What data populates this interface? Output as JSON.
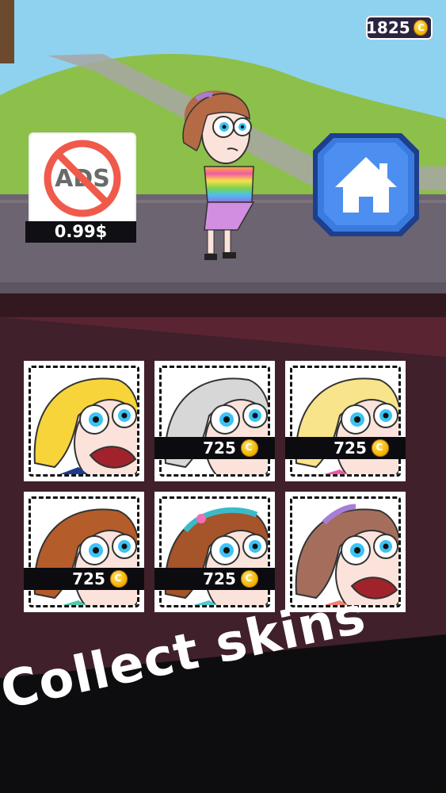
{
  "hud": {
    "coins": "1825",
    "coin_icon": "coin-icon"
  },
  "ads_offer": {
    "label": "ADS",
    "price": "0.99$"
  },
  "home": {
    "icon": "home-icon"
  },
  "skins": [
    {
      "hair": "#f7d43a",
      "price": null
    },
    {
      "hair": "#d7d7d7",
      "price": "725"
    },
    {
      "hair": "#f8e48a",
      "price": "725"
    },
    {
      "hair": "#b45c2a",
      "price": "725"
    },
    {
      "hair": "#a65429",
      "price": "725"
    },
    {
      "hair": "#a56e5c",
      "price": null
    }
  ],
  "banner": {
    "text": "Collect skins"
  },
  "colors": {
    "sky": "#8fd2f0",
    "grass": "#8cc04a",
    "road": "#6c6470",
    "panel": "#40202a",
    "home_blue": "#3a7be0"
  }
}
